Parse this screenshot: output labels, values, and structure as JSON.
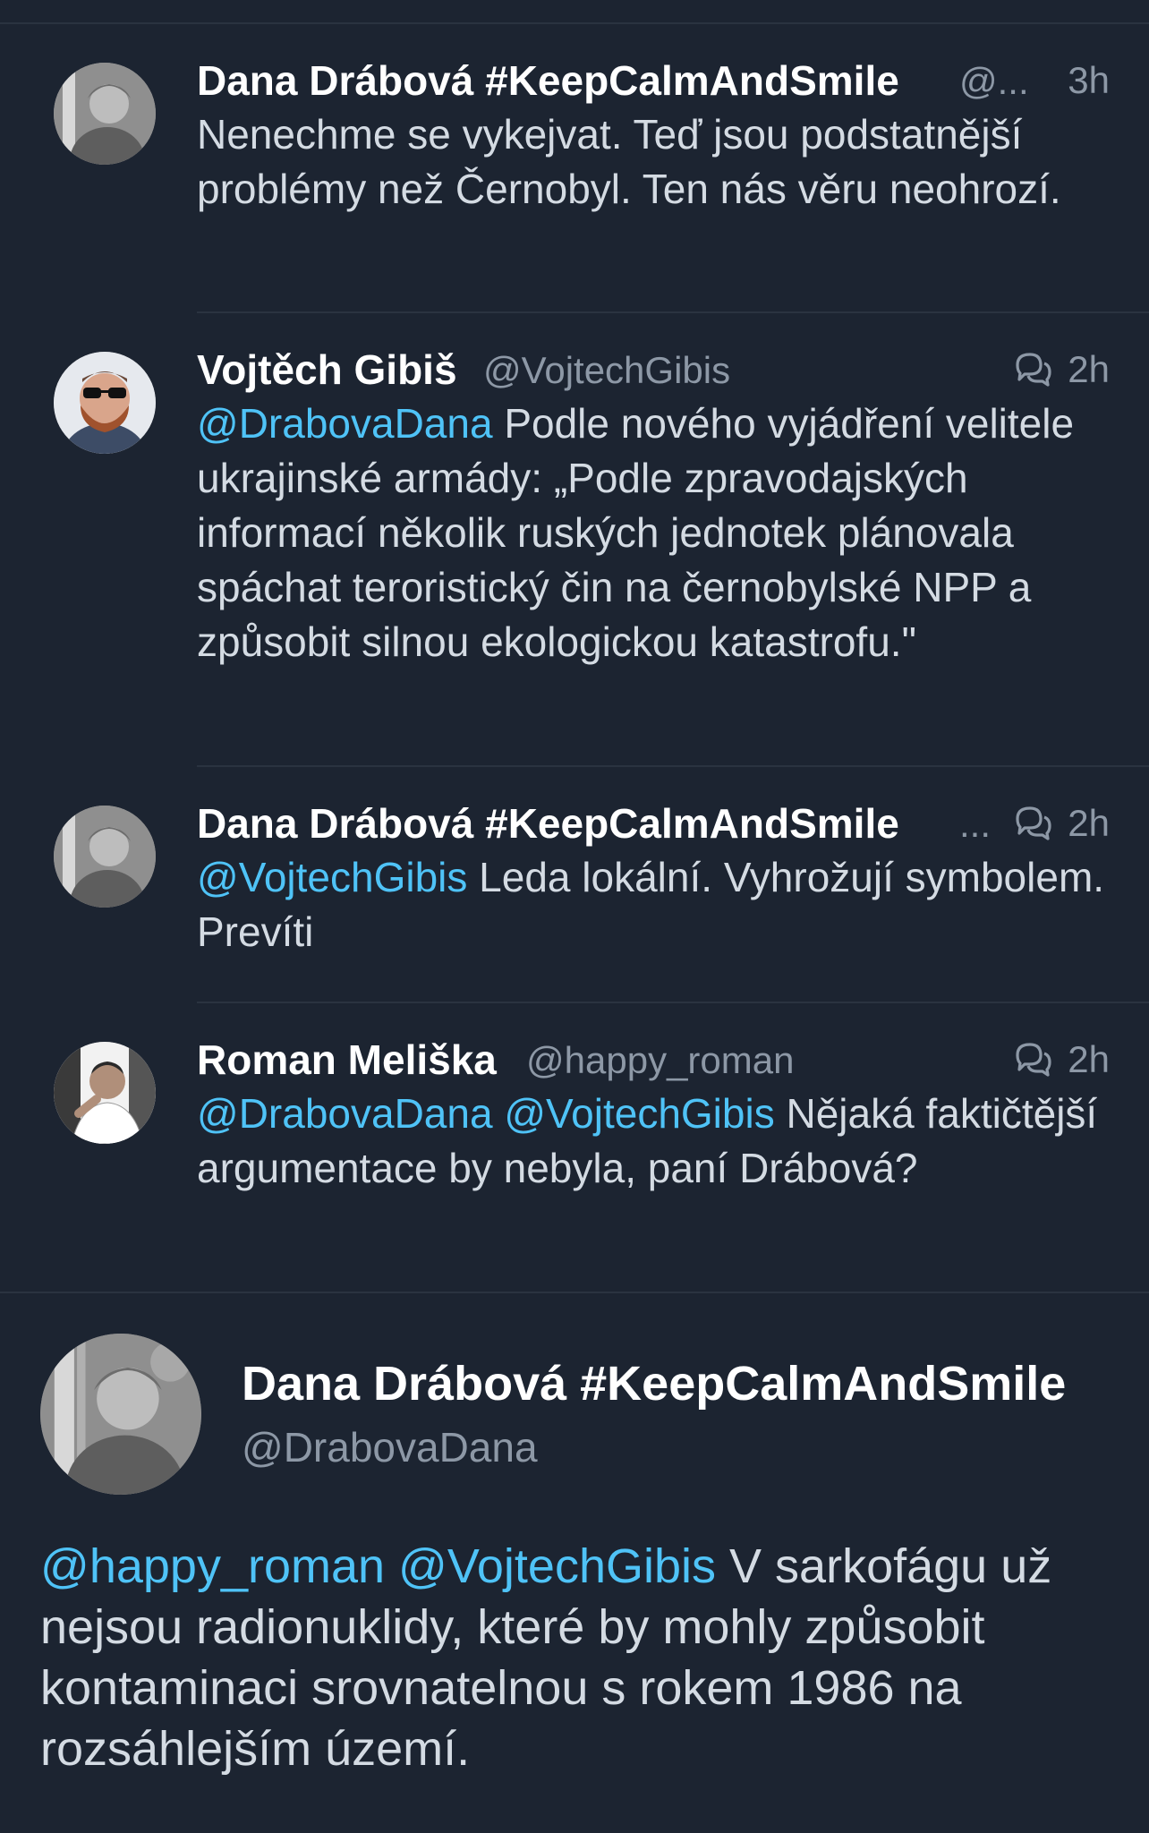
{
  "colors": {
    "background": "#1c2431",
    "text": "#d4dbe3",
    "name": "#ffffff",
    "secondary": "#8d98a6",
    "mention": "#4fc3f7",
    "divider": "#2a3340"
  },
  "thread": [
    {
      "name": "Dana Drábová #KeepCalmAndSmile",
      "handle": "@...",
      "time": "3h",
      "has_convo_icon": false,
      "mentions": "",
      "text": "Nenechme se vykejvat. Teď jsou podstatnější problémy než Černobyl. Ten nás věru neohrozí."
    },
    {
      "name": "Vojtěch Gibiš",
      "handle": "@VojtechGibis",
      "time": "2h",
      "has_convo_icon": true,
      "mentions": "@DrabovaDana",
      "text": " Podle nového vyjádření velitele ukrajinské armády: „Podle zpravodajských informací několik ruských jednotek plánovala spáchat teroristický čin na černobylské NPP a způsobit silnou ekologickou katastrofu.\""
    },
    {
      "name": "Dana Drábová #KeepCalmAndSmile",
      "handle": "...",
      "time": "2h",
      "has_convo_icon": true,
      "mentions": "@VojtechGibis",
      "text": " Leda lokální. Vyhrožují symbolem. Prevíti"
    },
    {
      "name": "Roman Meliška",
      "handle": "@happy_roman",
      "time": "2h",
      "has_convo_icon": true,
      "mentions": "@DrabovaDana @VojtechGibis",
      "text": " Nějaká faktičtější argumentace by nebyla, paní Drábová?"
    }
  ],
  "main_tweet": {
    "name": "Dana Drábová #KeepCalmAndSmile",
    "handle": "@DrabovaDana",
    "mentions": "@happy_roman @VojtechGibis",
    "text": " V sarkofágu už nejsou radionuklidy, které by mohly způsobit kontaminaci srovnatelnou s rokem 1986 na rozsáhlejším území."
  }
}
